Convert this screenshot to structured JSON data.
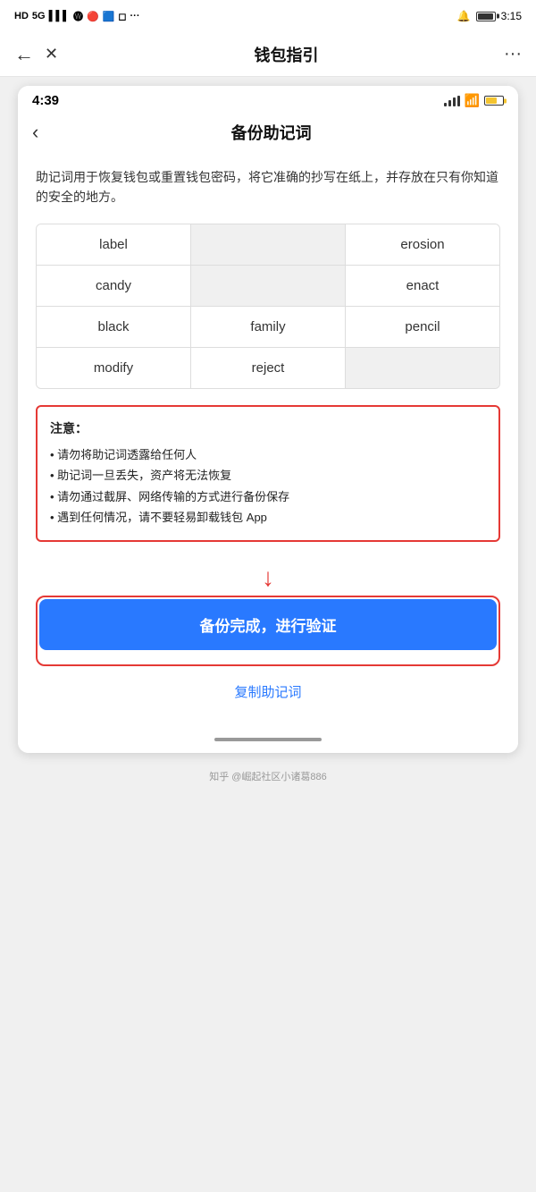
{
  "outer": {
    "status": {
      "left_icons": "HD 5G",
      "time": "3:15"
    },
    "nav": {
      "title": "钱包指引",
      "back_icon": "←",
      "close_icon": "✕",
      "more_icon": "···"
    }
  },
  "inner": {
    "status": {
      "time": "4:39"
    },
    "nav": {
      "title": "备份助记词",
      "back_icon": "‹"
    },
    "description": "助记词用于恢复钱包或重置钱包密码，将它准确的抄写在纸上，并存放在只有你知道的安全的地方。",
    "mnemonic_words": [
      [
        "label",
        "",
        "erosion"
      ],
      [
        "candy",
        "",
        "enact"
      ],
      [
        "black",
        "family",
        "pencil"
      ],
      [
        "modify",
        "reject",
        ""
      ]
    ],
    "warning": {
      "title": "注意：",
      "items": [
        "• 请勿将助记词透露给任何人",
        "• 助记词一旦丢失，资产将无法恢复",
        "• 请勿通过截屏、网络传输的方式进行备份保存",
        "• 遇到任何情况，请不要轻易卸载钱包 App"
      ]
    },
    "buttons": {
      "primary": "备份完成，进行验证",
      "copy": "复制助记词"
    }
  },
  "footer": {
    "text": "知乎 @崛起社区小诸葛886"
  }
}
